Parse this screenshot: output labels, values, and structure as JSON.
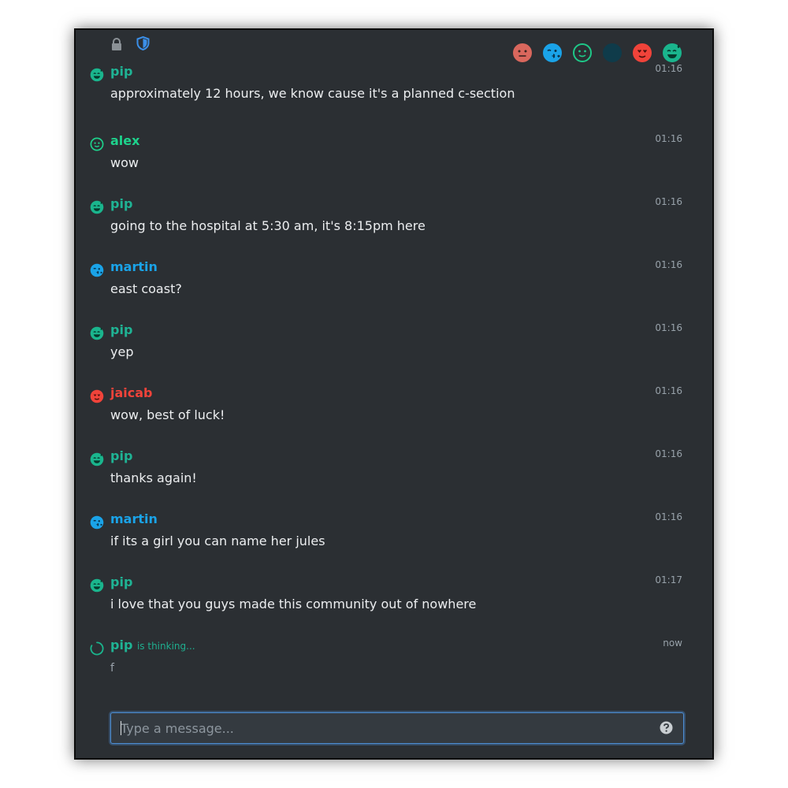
{
  "presence": [
    {
      "icon": "neutral-face-icon",
      "color": "#d9675d"
    },
    {
      "icon": "kiss-face-icon",
      "color": "#1aa3e8"
    },
    {
      "icon": "smile-outline-face-icon",
      "color": "#1ec888"
    },
    {
      "icon": "blank-face-icon",
      "color": "#0f3b4a"
    },
    {
      "icon": "heart-eyes-face-icon",
      "color": "#f0433a"
    },
    {
      "icon": "sweat-grin-face-icon",
      "color": "#1ab58d"
    }
  ],
  "messages": [
    {
      "user": "pip",
      "color": "#1fb394",
      "time": "01:16",
      "text": "approximately 12 hours, we know cause it's a planned c-section"
    },
    {
      "user": "alex",
      "color": "#1ed28c",
      "time": "01:16",
      "text": "wow"
    },
    {
      "user": "pip",
      "color": "#1fb394",
      "time": "01:16",
      "text": "going to the hospital at 5:30 am, it's 8:15pm here"
    },
    {
      "user": "martin",
      "color": "#1aa3e8",
      "time": "01:16",
      "text": "east coast?"
    },
    {
      "user": "pip",
      "color": "#1fb394",
      "time": "01:16",
      "text": "yep"
    },
    {
      "user": "jaicab",
      "color": "#f0433a",
      "time": "01:16",
      "text": "wow, best of luck!"
    },
    {
      "user": "pip",
      "color": "#1fb394",
      "time": "01:16",
      "text": "thanks again!"
    },
    {
      "user": "martin",
      "color": "#1aa3e8",
      "time": "01:16",
      "text": "if its a girl you can name her jules"
    },
    {
      "user": "pip",
      "color": "#1fb394",
      "time": "01:17",
      "text": "i love that you guys made this community out of nowhere"
    }
  ],
  "thinking": {
    "user": "pip",
    "label": "is thinking...",
    "time": "now",
    "text": "f",
    "color": "#1fb394"
  },
  "composer": {
    "placeholder": "Type a message...",
    "value": ""
  }
}
